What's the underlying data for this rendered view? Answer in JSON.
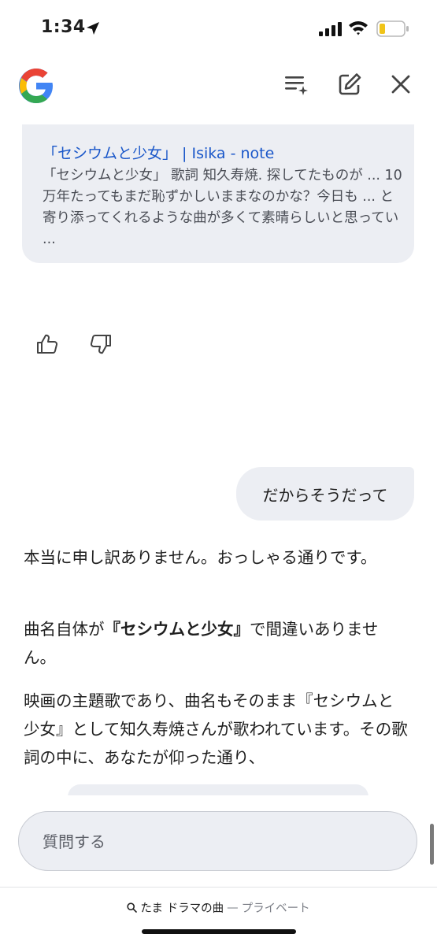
{
  "status_bar": {
    "time": "1:34"
  },
  "source_card": {
    "title": "「セシウムと少女」 | Isika - note",
    "snippet": "「セシウムと少女」 歌詞 知久寿焼. 探してたものが ... 10万年たってもまだ恥ずかしいままなのかな？今日も ... と寄り添ってくれるような曲が多くて素晴らしいと思ってい ..."
  },
  "user_message": "だからそうだって",
  "answer": {
    "p1": "本当に申し訳ありません。おっしゃる通りです。",
    "p2_prefix": "曲名自体が",
    "p2_bold": "『セシウムと少女』",
    "p2_suffix": "で間違いありません。",
    "p3": "映画の主題歌であり、曲名もそのまま『セシウムと少女』として知久寿焼さんが歌われています。その歌詞の中に、あなたが仰った通り、"
  },
  "input": {
    "placeholder": "質問する"
  },
  "footer": {
    "query": "たま ドラマの曲",
    "separator": " — ",
    "mode": "プライベート"
  },
  "colors": {
    "link": "#1a57c9",
    "surface": "#eceef3",
    "text": "#1f1f1f"
  }
}
